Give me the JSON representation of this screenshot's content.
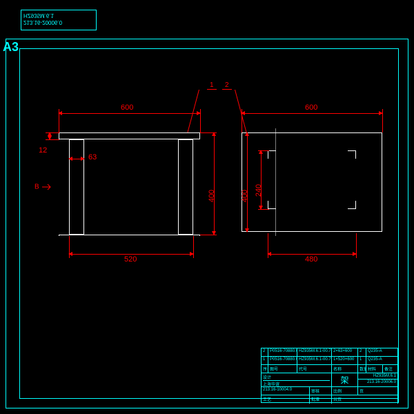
{
  "sheet": {
    "size": "A3"
  },
  "top_stamp": {
    "line1": "HZ935M.6.1",
    "line2": "213.16-20006.0"
  },
  "dims": {
    "top_left_600": "600",
    "top_right_600": "600",
    "left_12": "12",
    "left_63": "63",
    "height_400_left": "400",
    "height_400_right": "400",
    "height_240": "240",
    "bottom_520": "520",
    "bottom_480": "480"
  },
  "leaders": {
    "l1": "1",
    "l2": "2"
  },
  "section": {
    "b": "B"
  },
  "title_block": {
    "r1c1": "2",
    "r1c2": "P0516-70880.0",
    "r1c3": "HZ935M.6.1-00.7",
    "r1c4": "2×63×600",
    "r1c5": "2",
    "r1c6": "Q235-A",
    "r2c1": "1",
    "r2c2": "P0516-70880.0",
    "r2c3": "HZ935M.6.1-00.7",
    "r2c4": "1×520×600",
    "r2c5": "1",
    "r2c6": "Q235-A",
    "hdr1": "序号",
    "hdr2": "图号",
    "hdr3": "代号",
    "hdr4": "名称",
    "hdr5": "数量",
    "hdr6": "材料",
    "hdr7": "备注",
    "part_name": "架",
    "drawing_no": "HZ935M.6.1",
    "std_ref": "213.16-20006.0",
    "std_ref2": "213.16-10004.0",
    "proj": "上海华谊",
    "role1": "设计",
    "role2": "审核",
    "role3": "工艺",
    "role4": "批准",
    "scale_lbl": "比例",
    "sheet_lbl": "页",
    "page_lbl": "共页"
  }
}
